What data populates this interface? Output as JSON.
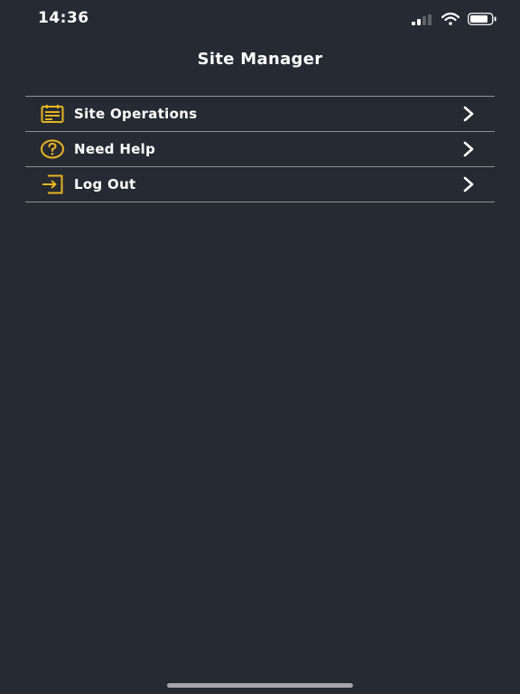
{
  "status_bar": {
    "time": "14:36",
    "icons": [
      "cellular-signal-icon",
      "wifi-icon",
      "battery-icon"
    ]
  },
  "nav": {
    "title": "Site Manager"
  },
  "menu": {
    "items": [
      {
        "label": "Site Operations",
        "icon": "calendar-icon"
      },
      {
        "label": "Need Help",
        "icon": "help-circle-icon"
      },
      {
        "label": "Log Out",
        "icon": "logout-icon"
      }
    ]
  },
  "colors": {
    "background": "#262b33",
    "accent": "#e8b323",
    "divider": "#8d9096",
    "text": "#ffffff"
  }
}
